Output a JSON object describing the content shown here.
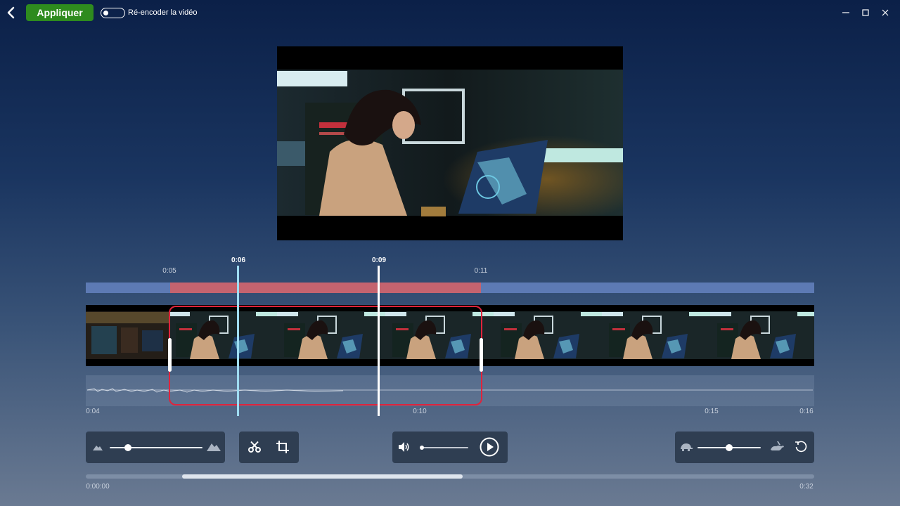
{
  "toolbar": {
    "apply_label": "Appliquer",
    "reencode_label": "Ré-encoder la vidéo",
    "reencode_enabled": false,
    "accent_color": "#2e8b1e"
  },
  "timeline": {
    "top_labels": {
      "start": "0:05",
      "end": "0:11",
      "playhead_a": "0:06",
      "playhead_b": "0:09"
    },
    "bottom_labels": {
      "start": "0:04",
      "mid": "0:10",
      "mark": "0:15",
      "end": "0:16"
    },
    "selection_color": "#e0233c",
    "range_color": "#5d7ab4"
  },
  "footer": {
    "elapsed": "0:00:00",
    "total": "0:32"
  },
  "controls": {
    "zoom_level": 0.2,
    "volume_level": 0.0,
    "speed_level": 0.5
  }
}
